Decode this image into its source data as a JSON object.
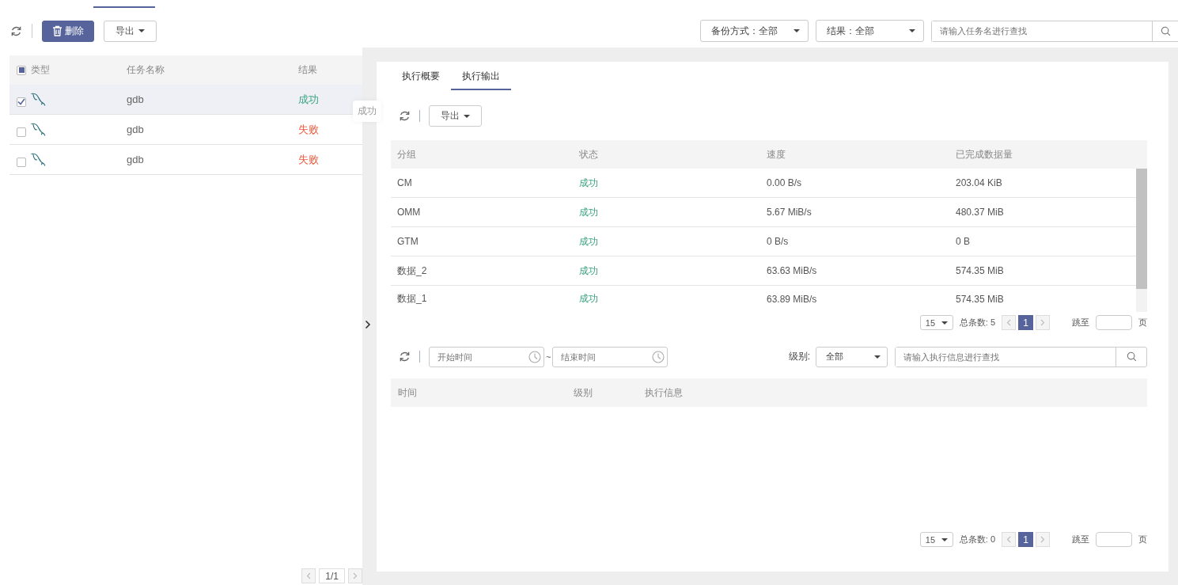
{
  "toolbar": {
    "delete_button": "删除",
    "export_button": "导出"
  },
  "filters": [
    {
      "label": "备份方式：全部"
    },
    {
      "label": "结果：全部"
    }
  ],
  "search": {
    "placeholder": "请输入任务名进行查找"
  },
  "task_table": {
    "columns": [
      "类型",
      "任务名称",
      "结果"
    ],
    "select_all": {
      "indeterminate": true
    },
    "rows": [
      {
        "checked": true,
        "selected": true,
        "name": "gdb",
        "result": "成功",
        "color": "#3aa37e"
      },
      {
        "checked": false,
        "selected": false,
        "name": "gdb",
        "result": "失败",
        "color": "#ef5a3c"
      },
      {
        "checked": false,
        "selected": false,
        "name": "gdb",
        "result": "失败",
        "color": "#ef5a3c"
      }
    ]
  },
  "tooltip": "成功",
  "task_pagination": {
    "page": "1/1"
  },
  "detail": {
    "tabs": [
      {
        "label": "执行概要",
        "selected": false
      },
      {
        "label": "执行输出",
        "selected": true
      }
    ],
    "export_button": "导出",
    "output_table": {
      "columns": [
        "分组",
        "状态",
        "速度",
        "已完成数据量"
      ],
      "rows": [
        {
          "group": "CM",
          "state": "成功",
          "speed": "0.00 B/s",
          "completed": "203.04 KiB"
        },
        {
          "group": "OMM",
          "state": "成功",
          "speed": "5.67 MiB/s",
          "completed": "480.37 MiB"
        },
        {
          "group": "GTM",
          "state": "成功",
          "speed": "0 B/s",
          "completed": "0 B"
        },
        {
          "group": "数据_2",
          "state": "成功",
          "speed": "63.63 MiB/s",
          "completed": "574.35 MiB"
        },
        {
          "group": "数据_1",
          "state": "成功",
          "speed": "63.89 MiB/s",
          "completed": "574.35 MiB"
        }
      ]
    },
    "output_pagination": {
      "page_size": "15",
      "total": "总条数: 5",
      "current_page": "1",
      "jump_label": "跳至",
      "page_unit": "页"
    },
    "log_filters": {
      "start_placeholder": "开始时间",
      "separator": "~",
      "end_placeholder": "结束时间",
      "level_label": "级别:",
      "level_value": "全部",
      "search_placeholder": "请输入执行信息进行查找"
    },
    "log_table": {
      "columns": [
        "时间",
        "级别",
        "执行信息"
      ]
    },
    "log_pagination": {
      "page_size": "15",
      "total": "总条数: 0",
      "current_page": "1",
      "jump_label": "跳至",
      "page_unit": "页"
    }
  }
}
